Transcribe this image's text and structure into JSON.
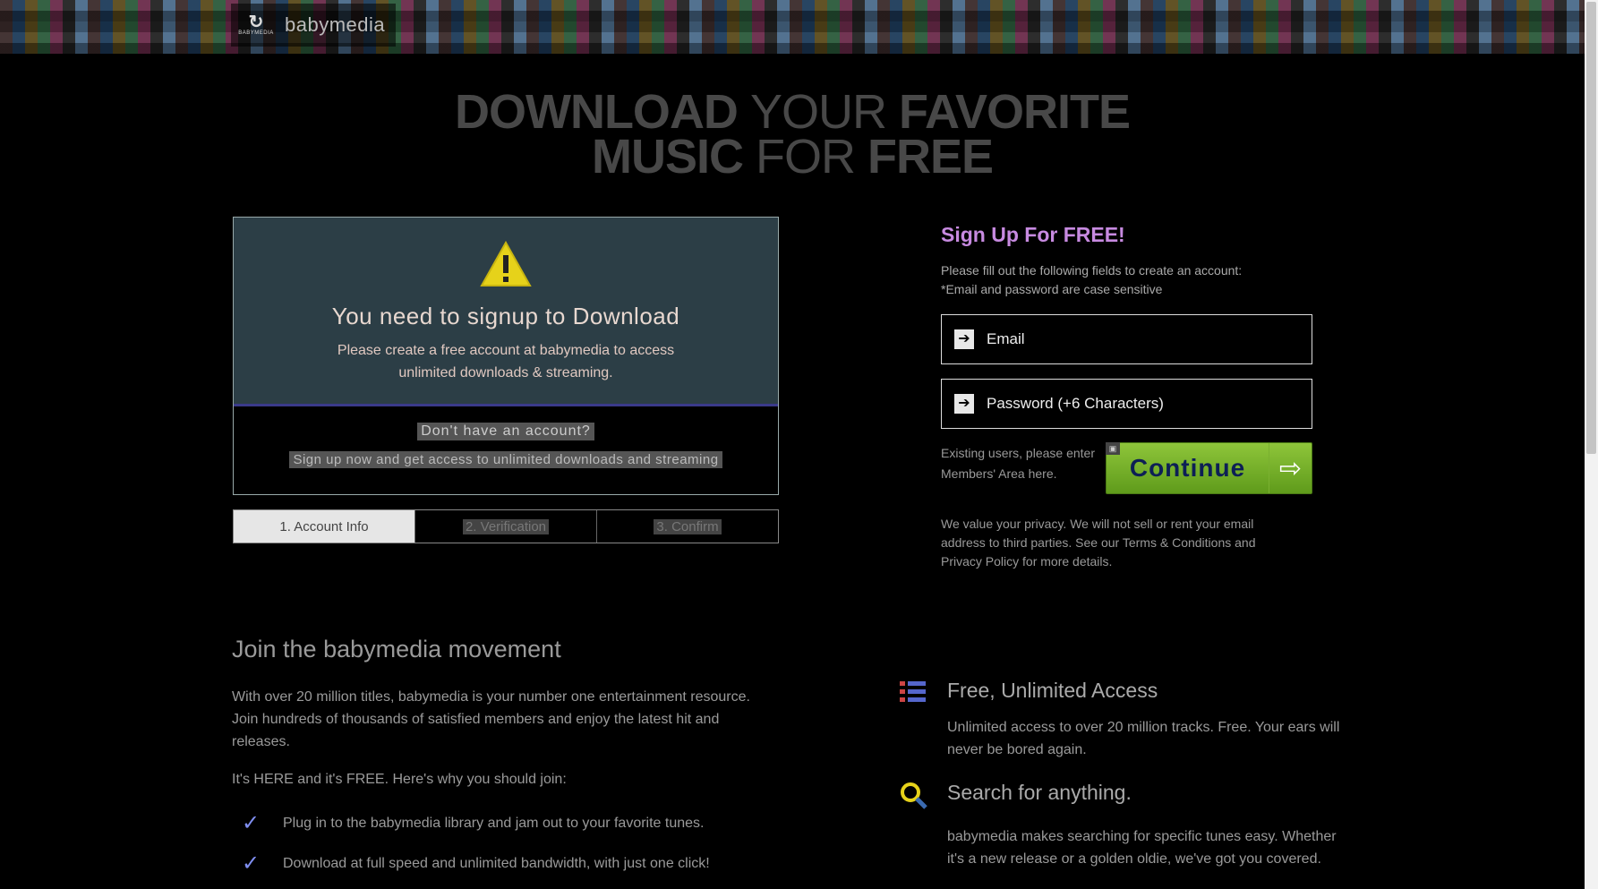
{
  "header": {
    "logo_small": "BABYMEDIA",
    "brand": "babymedia"
  },
  "hero": {
    "line1_bold": "DOWNLOAD",
    "line1_light": "YOUR",
    "line1_bold2": "FAVORITE",
    "line2_bold": "MUSIC",
    "line2_light": "FOR",
    "line2_bold2": "FREE"
  },
  "notice": {
    "title": "You need to signup to Download",
    "text_line1": "Please create a free account at babymedia to access",
    "text_line2": "unlimited downloads & streaming.",
    "sub1": "Don't have an account?",
    "sub2": "Sign up now and get access to unlimited downloads and streaming"
  },
  "steps": [
    {
      "label": "1. Account Info"
    },
    {
      "label": "2. Verification"
    },
    {
      "label": "3. Confirm"
    }
  ],
  "form": {
    "title": "Sign Up For FREE!",
    "desc_line1": "Please fill out the following fields to create an account:",
    "desc_line2": "*Email and password are case sensitive",
    "email_placeholder": "Email",
    "password_placeholder": "Password (+6 Characters)",
    "existing_line1": "Existing users, please enter",
    "existing_line2": "Members' Area here.",
    "continue": "Continue",
    "privacy": "We value your privacy. We will not sell or rent your email address to third parties. See our Terms & Conditions and Privacy Policy for more details."
  },
  "join": {
    "title": "Join the babymedia movement",
    "p1": "With over 20 million titles, babymedia is your number one entertainment resource. Join hundreds of thousands of satisfied members and enjoy the latest hit and releases.",
    "p2": "It's HERE and it's FREE. Here's why you should join:",
    "items": [
      "Plug in to the babymedia library and jam out to your favorite tunes.",
      "Download at full speed and unlimited bandwidth, with just one click!"
    ]
  },
  "features": [
    {
      "title": "Free, Unlimited Access",
      "desc": "Unlimited access to over 20 million tracks. Free. Your ears will never be bored again."
    },
    {
      "title": "Search for anything.",
      "desc": "babymedia makes searching for specific tunes easy. Whether it's a new release or a golden oldie, we've got you covered."
    }
  ],
  "colors": {
    "accent_purple": "#c78ae0",
    "continue_green": "#7bb52e",
    "notice_bg": "#2c3e46",
    "check_blue": "#7f8ef0"
  }
}
